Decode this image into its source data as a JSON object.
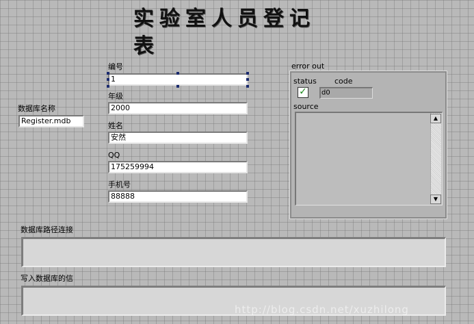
{
  "title": "实验室人员登记表",
  "db_name": {
    "label": "数据库名称",
    "value": "Register.mdb"
  },
  "fields": [
    {
      "label": "编号",
      "value": "1"
    },
    {
      "label": "年级",
      "value": "2000"
    },
    {
      "label": "姓名",
      "value": "安然"
    },
    {
      "label": "QQ",
      "value": "175259994"
    },
    {
      "label": "手机号",
      "value": "88888"
    }
  ],
  "error_out": {
    "label": "error out",
    "status_label": "status",
    "status_check": "✓",
    "code_label": "code",
    "code_value": "0",
    "code_prefix": "d",
    "source_label": "source"
  },
  "path_connect": {
    "label": "数据库路径连接",
    "value": ""
  },
  "write_info": {
    "label": "写入数据库的信",
    "value": ""
  },
  "watermark": "http://blog.csdn.net/xuzhilong",
  "scroll": {
    "up": "▲",
    "down": "▼"
  }
}
